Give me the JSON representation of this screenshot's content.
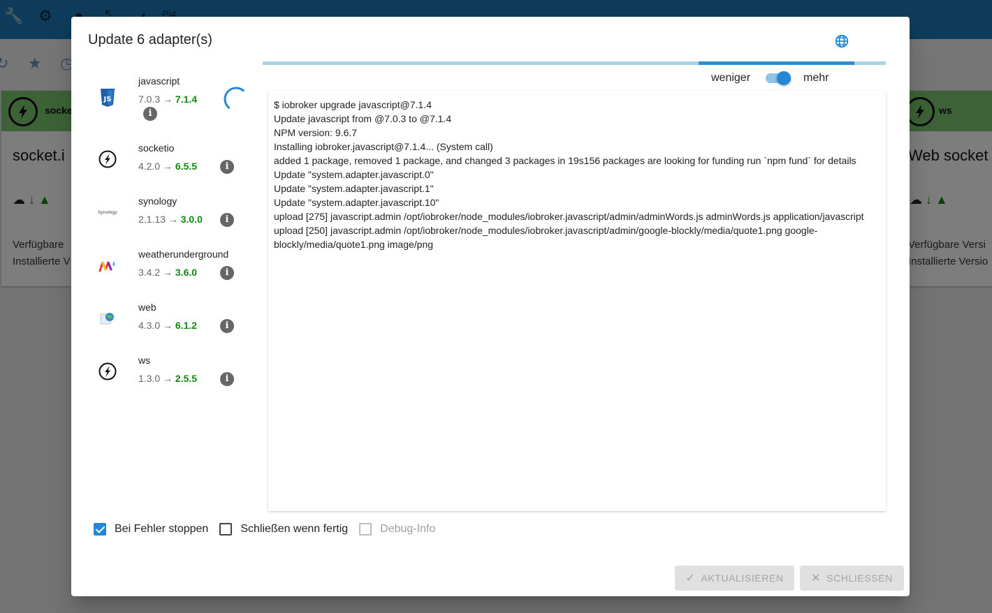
{
  "background": {
    "appbar_text": "Pi4",
    "cards": {
      "left": {
        "head_label": "socke",
        "title": "socket.i",
        "line1": "Verfügbare",
        "line2": "Installierte V"
      },
      "right": {
        "head_label": "ws",
        "title": "Web socket",
        "line1": "Verfügbare Versi",
        "line2": "Installierte Versio"
      }
    }
  },
  "dialog": {
    "title": "Update 6 adapter(s)",
    "progress_fraction_start": 0.7,
    "progress_fraction_end": 0.95,
    "toggle": {
      "left_label": "weniger",
      "right_label": "mehr",
      "on": true
    },
    "adapters": [
      {
        "name": "javascript",
        "old": "7.0.3",
        "new": "7.1.4",
        "icon": "javascript-logo-icon"
      },
      {
        "name": "socketio",
        "old": "4.2.0",
        "new": "6.5.5",
        "icon": "socketio-logo-icon"
      },
      {
        "name": "synology",
        "old": "2.1.13",
        "new": "3.0.0",
        "icon": "synology-logo-icon"
      },
      {
        "name": "weatherunderground",
        "old": "3.4.2",
        "new": "3.6.0",
        "icon": "weatherunderground-logo-icon"
      },
      {
        "name": "web",
        "old": "4.3.0",
        "new": "6.1.2",
        "icon": "web-logo-icon"
      },
      {
        "name": "ws",
        "old": "1.3.0",
        "new": "2.5.5",
        "icon": "ws-logo-icon"
      }
    ],
    "arrow": "→",
    "synology_logo_text": "Synology",
    "log": [
      "$ iobroker upgrade javascript@7.1.4",
      "Update javascript from @7.0.3 to @7.1.4",
      "NPM version: 9.6.7",
      "Installing iobroker.javascript@7.1.4... (System call)",
      "added 1 package, removed 1 package, and changed 3 packages in 19s156 packages are looking for funding run `npm fund` for details",
      "Update \"system.adapter.javascript.0\"",
      "Update \"system.adapter.javascript.1\"",
      "Update \"system.adapter.javascript.10\"",
      "upload [275] javascript.admin /opt/iobroker/node_modules/iobroker.javascript/admin/adminWords.js adminWords.js application/javascript",
      "upload [250] javascript.admin /opt/iobroker/node_modules/iobroker.javascript/admin/google-blockly/media/quote1.png google-blockly/media/quote1.png image/png"
    ],
    "checkboxes": {
      "stop_on_error": {
        "label": "Bei Fehler stoppen",
        "checked": true
      },
      "close_when_done": {
        "label": "Schließen wenn fertig",
        "checked": false
      },
      "debug_info": {
        "label": "Debug-Info",
        "checked": false,
        "disabled": true
      }
    },
    "buttons": {
      "update": "AKTUALISIEREN",
      "close": "SCHLIESSEN"
    }
  },
  "colors": {
    "accent": "#2388d8",
    "version_new": "#118811",
    "appbar": "#1f78b4",
    "card_head": "#7bc46f"
  }
}
